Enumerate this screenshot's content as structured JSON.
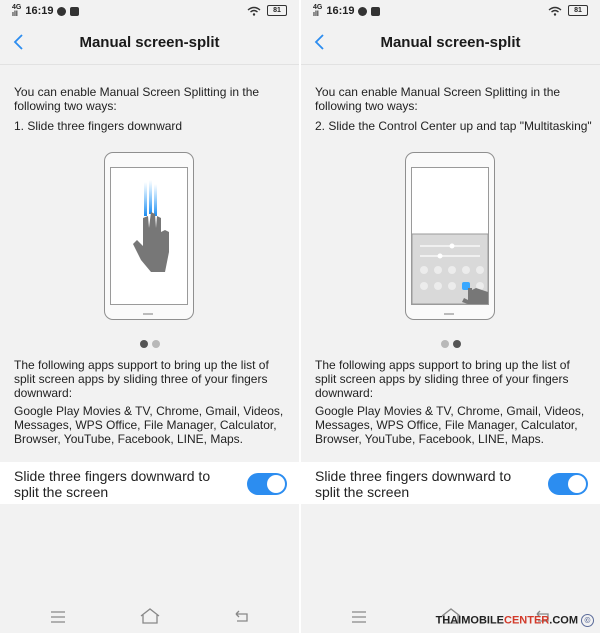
{
  "colors": {
    "accent": "#2c8df0",
    "background": "#f2f2f2"
  },
  "panes": [
    {
      "status": {
        "network": "4G",
        "signal": "ıll",
        "time": "16:19",
        "battery": "81"
      },
      "title": "Manual screen-split",
      "intro": "You can enable Manual Screen Splitting in the following two ways:",
      "step": "1. Slide three fingers downward",
      "illustration": "three-finger-swipe",
      "pager": {
        "count": 2,
        "active": 0
      },
      "support_text": "The following apps support to bring up the list of split screen apps by sliding three of your fingers downward:",
      "apps_text": "Google Play Movies & TV, Chrome, Gmail, Videos, Messages, WPS Office, File Manager, Calculator, Browser, YouTube, Facebook, LINE, Maps.",
      "setting_label": "Slide three fingers downward to split the screen",
      "toggle_on": true
    },
    {
      "status": {
        "network": "4G",
        "signal": "ıll",
        "time": "16:19",
        "battery": "81"
      },
      "title": "Manual screen-split",
      "intro": "You can enable Manual Screen Splitting in the following two ways:",
      "step": "2. Slide the Control Center up and tap \"Multitasking\"",
      "illustration": "control-center-tap",
      "pager": {
        "count": 2,
        "active": 1
      },
      "support_text": "The following apps support to bring up the list of split screen apps by sliding three of your fingers downward:",
      "apps_text": "Google Play Movies & TV, Chrome, Gmail, Videos, Messages, WPS Office, File Manager, Calculator, Browser, YouTube, Facebook, LINE, Maps.",
      "setting_label": "Slide three fingers downward to split the screen",
      "toggle_on": true
    }
  ],
  "watermark": {
    "main": "THAIMOBILE",
    "accent": "CENTER",
    "suffix": ".COM",
    "mark": "©"
  }
}
